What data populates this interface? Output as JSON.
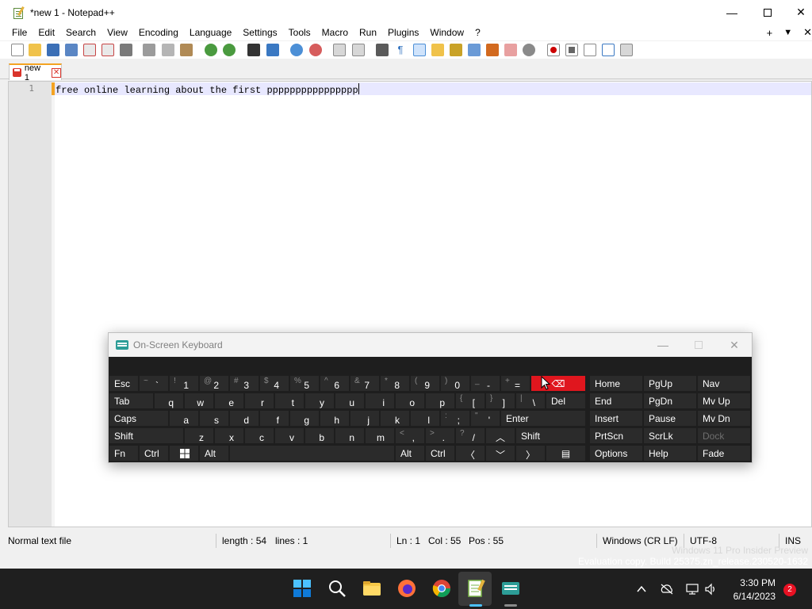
{
  "window": {
    "title": "*new 1 - Notepad++",
    "minimize_glyph": "—",
    "close_glyph": "✕"
  },
  "menu": {
    "items": [
      "File",
      "Edit",
      "Search",
      "View",
      "Encoding",
      "Language",
      "Settings",
      "Tools",
      "Macro",
      "Run",
      "Plugins",
      "Window",
      "?"
    ],
    "right_plus": "+",
    "right_dropdown": "▼",
    "right_close": "✕"
  },
  "tab": {
    "label": "new 1",
    "close_glyph": "✕"
  },
  "editor": {
    "line_number": "1",
    "text": "free online learning about the first pppppppppppppppp"
  },
  "status": {
    "file_type": "Normal text file",
    "length": "length : 54",
    "lines": "lines : 1",
    "ln": "Ln : 1",
    "col": "Col : 55",
    "pos": "Pos : 55",
    "eol": "Windows (CR LF)",
    "encoding": "UTF-8",
    "mode": "INS"
  },
  "watermark": {
    "line1": "Windows 11 Pro Insider Preview",
    "line2": "Evaluation copy. Build 25375.zn_release.230520-1632"
  },
  "osk": {
    "title": "On-Screen Keyboard",
    "minimize_glyph": "—",
    "close_glyph": "✕",
    "keys": {
      "esc": "Esc",
      "tab": "Tab",
      "caps": "Caps",
      "shift_left": "Shift",
      "fn": "Fn",
      "ctrl_left": "Ctrl",
      "alt_left": "Alt",
      "alt_right": "Alt",
      "ctrl_right": "Ctrl",
      "del": "Del",
      "enter": "Enter",
      "shift_right": "Shift",
      "home": "Home",
      "pgup": "PgUp",
      "nav": "Nav",
      "end": "End",
      "pgdn": "PgDn",
      "mvup": "Mv Up",
      "insert": "Insert",
      "pause": "Pause",
      "mvdn": "Mv Dn",
      "prtscn": "PrtScn",
      "scrlk": "ScrLk",
      "dock": "Dock",
      "options": "Options",
      "help": "Help",
      "fade": "Fade",
      "backspace": "⌫",
      "left": "〈",
      "down": "﹀",
      "right": "〉",
      "up": "︿",
      "menu": "▤"
    },
    "row1": [
      {
        "main": "`",
        "shift": "~"
      },
      {
        "main": "1",
        "shift": "!"
      },
      {
        "main": "2",
        "shift": "@"
      },
      {
        "main": "3",
        "shift": "#"
      },
      {
        "main": "4",
        "shift": "$"
      },
      {
        "main": "5",
        "shift": "%"
      },
      {
        "main": "6",
        "shift": "^"
      },
      {
        "main": "7",
        "shift": "&"
      },
      {
        "main": "8",
        "shift": "*"
      },
      {
        "main": "9",
        "shift": "("
      },
      {
        "main": "0",
        "shift": ")"
      },
      {
        "main": "-",
        "shift": "_"
      },
      {
        "main": "=",
        "shift": "+"
      }
    ],
    "row2": [
      "q",
      "w",
      "e",
      "r",
      "t",
      "y",
      "u",
      "i",
      "o",
      "p"
    ],
    "row2_extra": [
      {
        "main": "[",
        "shift": "{"
      },
      {
        "main": "]",
        "shift": "}"
      },
      {
        "main": "\\",
        "shift": "|"
      }
    ],
    "row3": [
      "a",
      "s",
      "d",
      "f",
      "g",
      "h",
      "j",
      "k",
      "l"
    ],
    "row3_extra": [
      {
        "main": ";",
        "shift": ":"
      },
      {
        "main": "'",
        "shift": "\""
      }
    ],
    "row4": [
      "z",
      "x",
      "c",
      "v",
      "b",
      "n",
      "m"
    ],
    "row4_extra": [
      {
        "main": ",",
        "shift": "<"
      },
      {
        "main": ".",
        "shift": ">"
      },
      {
        "main": "/",
        "shift": "?"
      }
    ]
  },
  "taskbar": {
    "time": "3:30 PM",
    "date": "6/14/2023",
    "notifications": "2"
  },
  "colors": {
    "osk_active_key": "#e0161e",
    "tab_accent": "#f4a322",
    "current_line": "#e8e8ff"
  }
}
